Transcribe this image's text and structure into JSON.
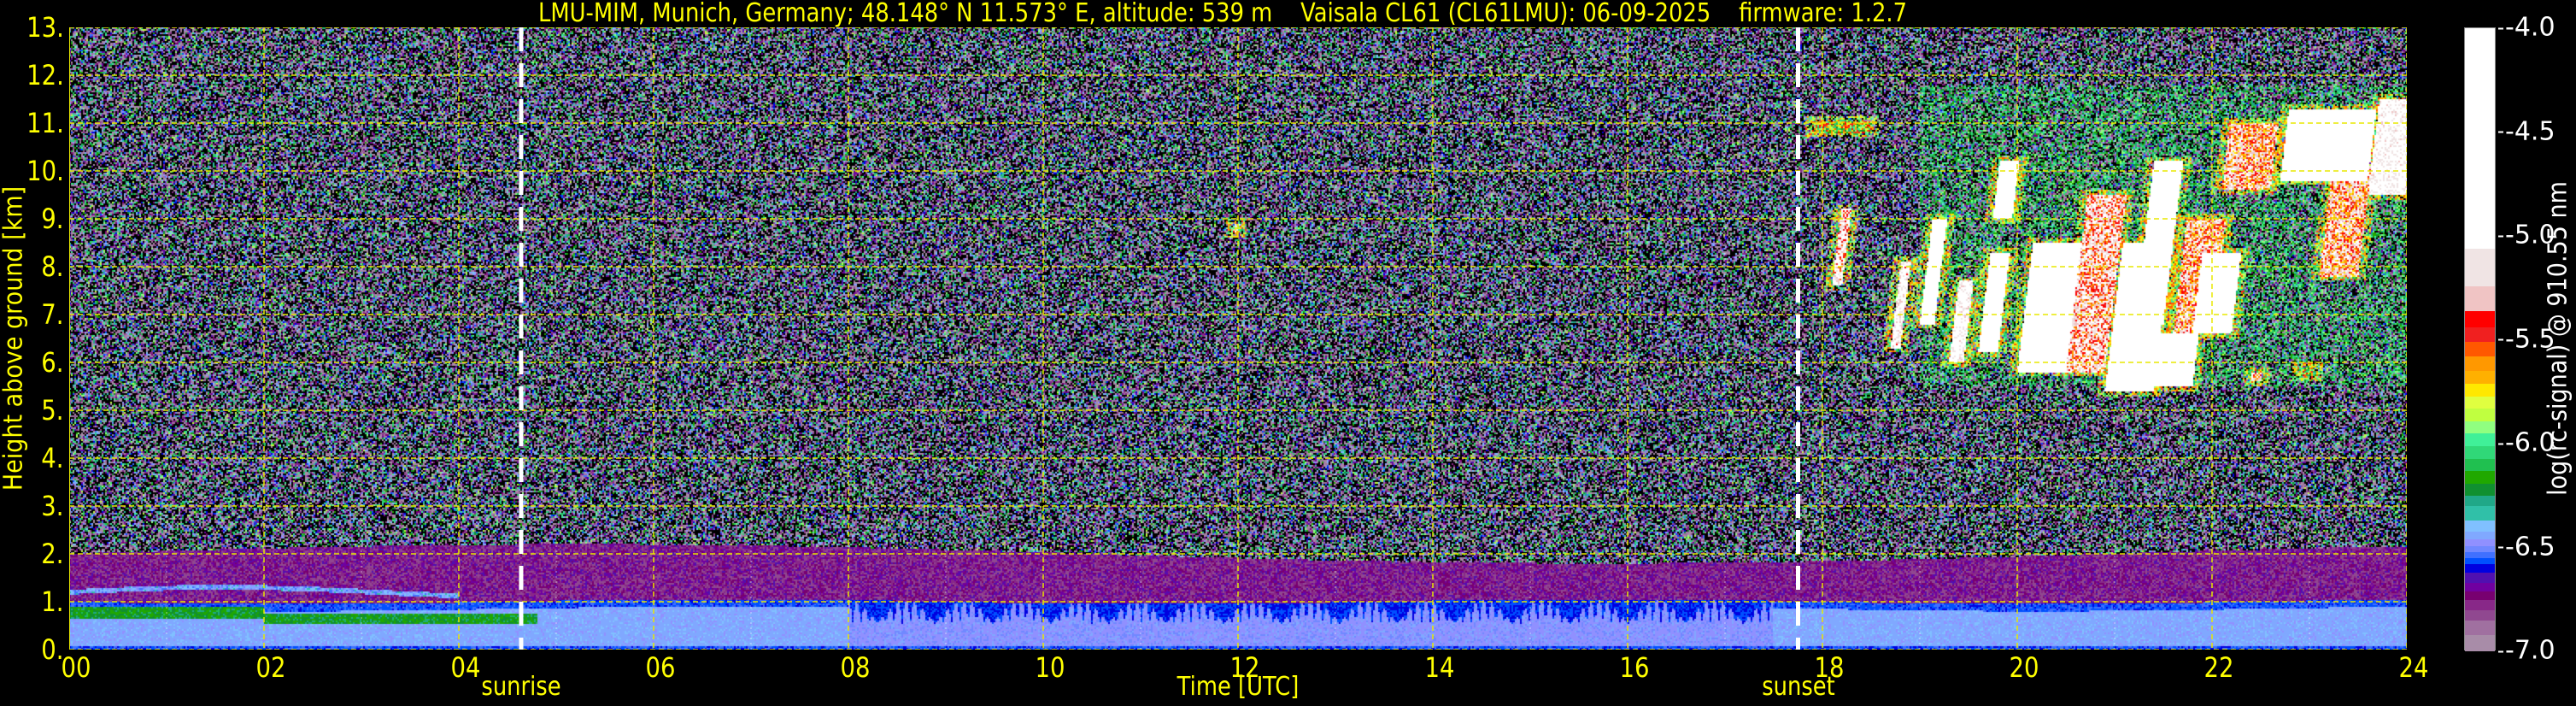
{
  "chart_data": {
    "type": "heatmap",
    "title": "LMU-MIM, Munich, Germany; 48.148° N 11.573° E, altitude: 539 m    Vaisala CL61 (CL61LMU): 06-09-2025    firmware: 1.2.7",
    "xlabel": "Time [UTC]",
    "ylabel": "Height above ground [km]",
    "xlim": [
      0,
      24
    ],
    "ylim": [
      0,
      13
    ],
    "xticks": [
      0,
      2,
      4,
      6,
      8,
      10,
      12,
      14,
      16,
      18,
      20,
      22,
      24
    ],
    "xtick_labels": [
      "00",
      "02",
      "04",
      "06",
      "08",
      "10",
      "12",
      "14",
      "16",
      "18",
      "20",
      "22",
      "24"
    ],
    "yticks": [
      0,
      1,
      2,
      3,
      4,
      5,
      6,
      7,
      8,
      9,
      10,
      11,
      12,
      13
    ],
    "ytick_labels": [
      "0.",
      "1.",
      "2.",
      "3.",
      "4.",
      "5.",
      "6.",
      "7.",
      "8.",
      "9.",
      "10.",
      "11.",
      "12.",
      "13."
    ],
    "grid": true,
    "annotations": [
      {
        "text": "sunrise",
        "x": 4.64
      },
      {
        "text": "sunset",
        "x": 17.75
      }
    ],
    "colorbar": {
      "label": "log(rc-signal) @ 910.55 nm",
      "range": [
        -7.0,
        -4.0
      ],
      "ticks": [
        -4.0,
        -4.5,
        -5.0,
        -5.5,
        -6.0,
        -6.5,
        -7.0
      ],
      "tick_labels": [
        "-4.0",
        "-4.5",
        "-5.0",
        "-5.5",
        "-6.0",
        "-6.5",
        "-7.0"
      ],
      "levels": [
        [
          -7.0,
          "#a88ca8"
        ],
        [
          -6.92,
          "#a070a0"
        ],
        [
          -6.85,
          "#904890"
        ],
        [
          -6.8,
          "#882888"
        ],
        [
          -6.75,
          "#780070"
        ],
        [
          -6.71,
          "#7000a0"
        ],
        [
          -6.67,
          "#5010b0"
        ],
        [
          -6.62,
          "#0000e0"
        ],
        [
          -6.58,
          "#0050ff"
        ],
        [
          -6.55,
          "#4070ff"
        ],
        [
          -6.52,
          "#7088ff"
        ],
        [
          -6.49,
          "#9090ff"
        ],
        [
          -6.46,
          "#80a8ff"
        ],
        [
          -6.42,
          "#80c0ff"
        ],
        [
          -6.37,
          "#30c0a8"
        ],
        [
          -6.3,
          "#20a888"
        ],
        [
          -6.25,
          "#109030"
        ],
        [
          -6.19,
          "#20a800"
        ],
        [
          -6.13,
          "#20c050"
        ],
        [
          -6.07,
          "#30d878"
        ],
        [
          -6.01,
          "#40f098"
        ],
        [
          -5.95,
          "#90ff80"
        ],
        [
          -5.89,
          "#c0ff40"
        ],
        [
          -5.83,
          "#e0ff40"
        ],
        [
          -5.77,
          "#ffe800"
        ],
        [
          -5.71,
          "#ffb000"
        ],
        [
          -5.65,
          "#ff9800"
        ],
        [
          -5.58,
          "#ff5800"
        ],
        [
          -5.51,
          "#f02020"
        ],
        [
          -5.44,
          "#ff0000"
        ],
        [
          -5.36,
          "#f0c4c4"
        ],
        [
          -5.24,
          "#f0e4e4"
        ],
        [
          -5.06,
          "#ffffff"
        ]
      ]
    },
    "layers": {
      "boundary_layer_top_km": 1.0,
      "residual_layer_top_km": 2.0,
      "aerosol_layer": {
        "start_hour": 0,
        "end_hour": 4.8,
        "base_km": 0.55,
        "top_km": 0.9,
        "value": -6.2
      }
    },
    "cloud_features": [
      [
        17.9,
        18.5,
        10.8,
        11.05,
        -6.0
      ],
      [
        18.1,
        18.2,
        7.6,
        9.2,
        -5.3
      ],
      [
        18.7,
        18.8,
        6.3,
        8.1,
        -5.1
      ],
      [
        19.0,
        19.15,
        6.8,
        9.0,
        -4.6
      ],
      [
        19.3,
        19.45,
        6.0,
        7.7,
        -5.0
      ],
      [
        19.6,
        19.8,
        6.2,
        8.3,
        -4.5
      ],
      [
        19.75,
        19.95,
        9.0,
        10.2,
        -4.5
      ],
      [
        20.0,
        20.5,
        5.8,
        8.5,
        -4.3
      ],
      [
        20.5,
        20.9,
        5.8,
        9.5,
        -5.4
      ],
      [
        20.9,
        21.4,
        5.4,
        8.5,
        -4.6
      ],
      [
        21.2,
        21.5,
        6.8,
        10.2,
        -4.4
      ],
      [
        21.4,
        21.8,
        5.5,
        6.6,
        -4.7
      ],
      [
        21.6,
        22.0,
        6.6,
        9.0,
        -5.5
      ],
      [
        21.8,
        22.2,
        6.6,
        8.3,
        -4.3
      ],
      [
        22.1,
        22.6,
        9.6,
        11.0,
        -5.5
      ],
      [
        22.7,
        23.6,
        9.8,
        11.3,
        -4.4
      ],
      [
        23.1,
        23.5,
        7.8,
        10.1,
        -5.5
      ],
      [
        23.6,
        24.0,
        9.5,
        11.5,
        -5.0
      ],
      [
        22.4,
        22.5,
        5.6,
        5.8,
        -5.4
      ],
      [
        22.9,
        23.05,
        5.7,
        5.9,
        -6.0
      ],
      [
        11.95,
        12.0,
        8.7,
        8.9,
        -5.6
      ]
    ]
  }
}
